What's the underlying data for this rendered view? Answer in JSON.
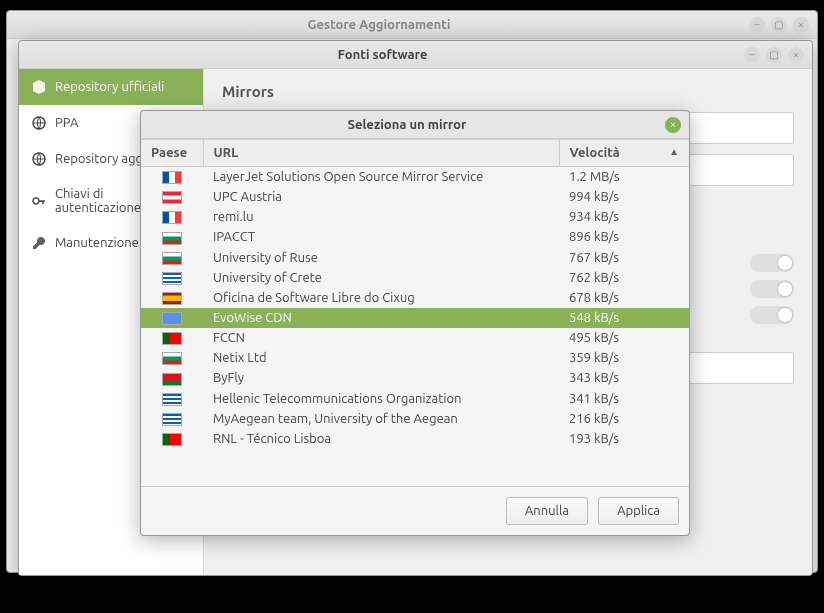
{
  "win_update": {
    "title": "Gestore Aggiornamenti"
  },
  "win_fonts": {
    "title": "Fonti software",
    "sidebar": [
      {
        "label": "Repository ufficiali",
        "icon": "cube-icon",
        "selected": true
      },
      {
        "label": "PPA",
        "icon": "globe-icon"
      },
      {
        "label": "Repository aggiuntivi",
        "icon": "globe-icon"
      },
      {
        "label": "Chiavi di autenticazione",
        "icon": "key-icon"
      },
      {
        "label": "Manutenzione",
        "icon": "wrench-icon"
      }
    ],
    "section_title": "Mirrors"
  },
  "dialog": {
    "title": "Seleziona un mirror",
    "columns": {
      "country": "Paese",
      "url": "URL",
      "speed": "Velocità"
    },
    "sort_column": "speed",
    "sort_dir": "desc",
    "rows": [
      {
        "flag": "fr",
        "url": "LayerJet Solutions Open Source Mirror Service",
        "speed": "1.2 MB/s"
      },
      {
        "flag": "at",
        "url": "UPC Austria",
        "speed": "994 kB/s"
      },
      {
        "flag": "fr",
        "url": "remi.lu",
        "speed": "934 kB/s"
      },
      {
        "flag": "bg",
        "url": "IPACCT",
        "speed": "896 kB/s"
      },
      {
        "flag": "bg",
        "url": "University of Ruse",
        "speed": "767 kB/s"
      },
      {
        "flag": "gr",
        "url": "University of Crete",
        "speed": "762 kB/s"
      },
      {
        "flag": "es",
        "url": "Oficina de Software Libre do Cixug",
        "speed": "678 kB/s"
      },
      {
        "flag": "un",
        "url": "EvoWise CDN",
        "speed": "548 kB/s",
        "selected": true
      },
      {
        "flag": "pt",
        "url": "FCCN",
        "speed": "495 kB/s"
      },
      {
        "flag": "bg",
        "url": "Netix Ltd",
        "speed": "359 kB/s"
      },
      {
        "flag": "by",
        "url": "ByFly",
        "speed": "343 kB/s"
      },
      {
        "flag": "gr",
        "url": "Hellenic Telecommunications Organization",
        "speed": "341 kB/s"
      },
      {
        "flag": "gr",
        "url": "MyAegean team, University of the Aegean",
        "speed": "216 kB/s"
      },
      {
        "flag": "pt",
        "url": "RNL - Técnico Lisboa",
        "speed": "193 kB/s"
      }
    ],
    "buttons": {
      "cancel": "Annulla",
      "apply": "Applica"
    }
  },
  "flags": {
    "fr": "linear-gradient(90deg,#0055a4 33%,#fff 33%,#fff 66%,#ef4135 66%)",
    "at": "linear-gradient(#ed2939 33%,#fff 33%,#fff 66%,#ed2939 66%)",
    "bg": "linear-gradient(#fff 33%,#00966e 33%,#00966e 66%,#d62612 66%)",
    "gr": "repeating-linear-gradient(#0d5eaf 0 2px,#fff 2px 4px)",
    "es": "linear-gradient(#aa151b 25%,#f1bf00 25%,#f1bf00 75%,#aa151b 75%)",
    "un": "#5b92e5",
    "pt": "linear-gradient(90deg,#006600 40%,#ff0000 40%)",
    "by": "linear-gradient(#ce1720 66%,#007c30 66%)"
  }
}
